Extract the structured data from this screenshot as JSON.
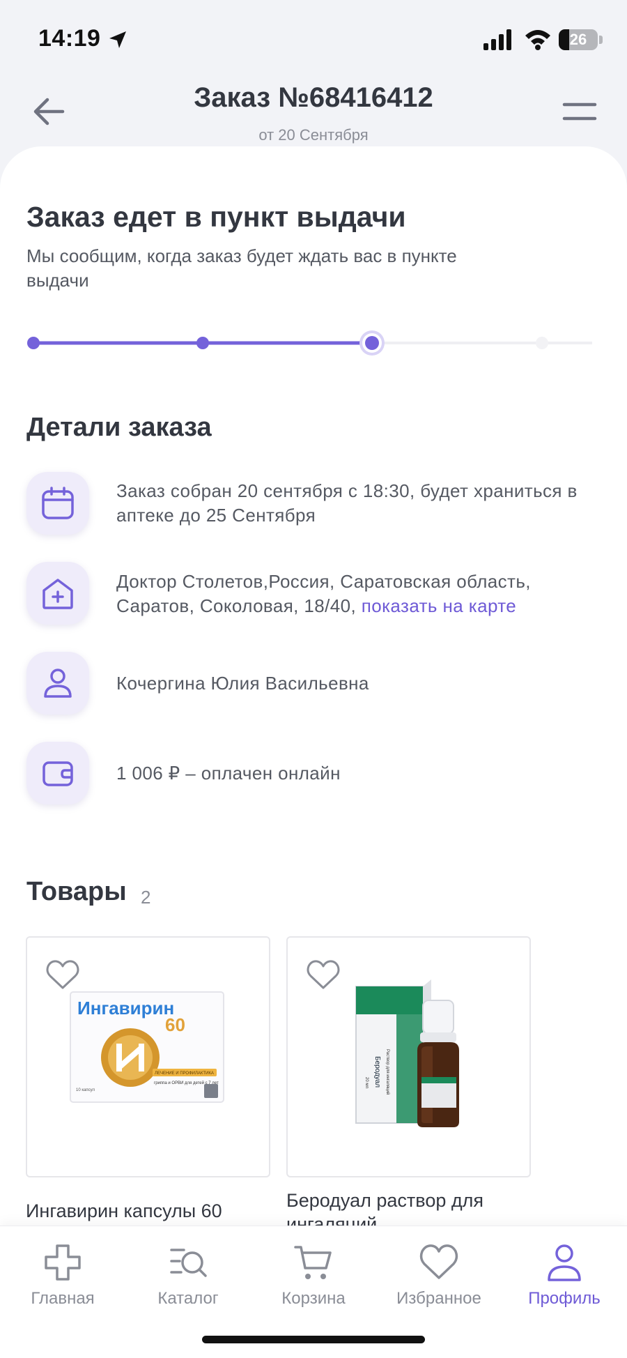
{
  "status_bar": {
    "time": "14:19",
    "battery": "26"
  },
  "header": {
    "title": "Заказ №68416412",
    "subtitle": "от 20 Сентября"
  },
  "order_status": {
    "heading": "Заказ едет в пункт выдачи",
    "description": "Мы сообщим, когда заказ будет ждать вас в пункте выдачи",
    "progress_step": 3,
    "progress_total": 4
  },
  "details": {
    "heading": "Детали заказа",
    "items": [
      {
        "icon": "calendar-icon",
        "text": "Заказ собран 20 сентября с 18:30, будет храниться в аптеке до 25 Сентября"
      },
      {
        "icon": "pharmacy-icon",
        "text": "Доктор Столетов,Россия, Саратовская область, Саратов, Соколовая, 18/40, ",
        "link": "показать на карте"
      },
      {
        "icon": "user-icon",
        "text": "Кочергина Юлия Васильевна"
      },
      {
        "icon": "wallet-icon",
        "text": "1 006 ₽ – оплачен онлайн"
      }
    ]
  },
  "goods": {
    "heading": "Товары",
    "count": "2",
    "products": [
      {
        "name": "Ингавирин капсулы 60",
        "image": {
          "brand": "Ингавирин",
          "dose": "60",
          "strip": "ЛЕЧЕНИЕ И ПРОФИЛАКТИКА",
          "sub": "гриппа и ОРВИ для детей с 7 лет",
          "pack": "10 капсул"
        }
      },
      {
        "name": "Беродуал раствор для ингаляций",
        "image": {
          "brand": "Беродуал",
          "sub": "Раствор для ингаляций",
          "volume": "20 мл"
        }
      }
    ]
  },
  "nav": {
    "items": [
      {
        "label": "Главная",
        "icon": "home-cross-icon",
        "active": false
      },
      {
        "label": "Каталог",
        "icon": "catalog-search-icon",
        "active": false
      },
      {
        "label": "Корзина",
        "icon": "cart-icon",
        "active": false
      },
      {
        "label": "Избранное",
        "icon": "heart-icon",
        "active": false
      },
      {
        "label": "Профиль",
        "icon": "profile-icon",
        "active": true
      }
    ]
  },
  "colors": {
    "accent": "#7462da",
    "text": "#333740",
    "muted": "#8a8d96",
    "icon_bg": "#efecfa"
  }
}
